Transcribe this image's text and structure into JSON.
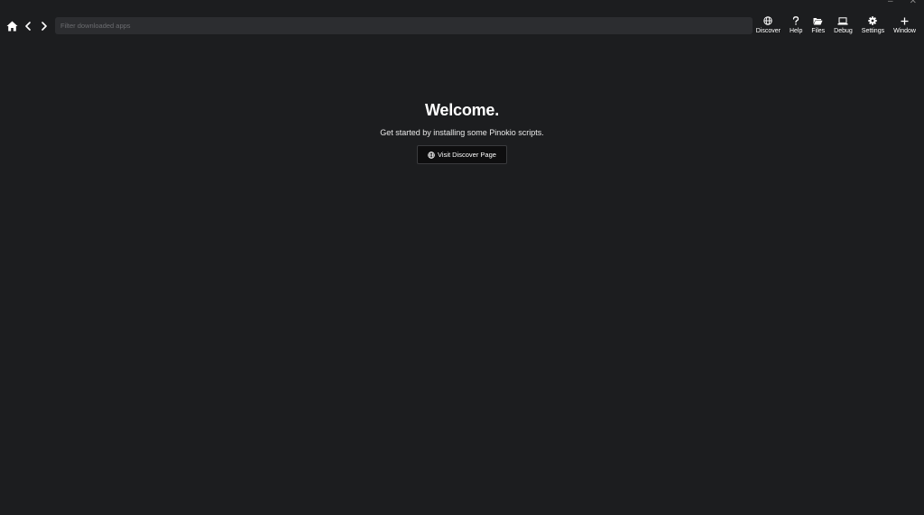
{
  "window": {
    "minimize_glyph": "–",
    "close_glyph": "✕"
  },
  "nav": {
    "home_icon": "home-icon",
    "back_icon": "chevron-left-icon",
    "forward_icon": "chevron-right-icon"
  },
  "search": {
    "placeholder": "Filter downloaded apps",
    "value": ""
  },
  "toolbar": {
    "items": [
      {
        "label": "Discover",
        "icon": "globe-icon"
      },
      {
        "label": "Help",
        "icon": "question-icon"
      },
      {
        "label": "Files",
        "icon": "folder-open-icon"
      },
      {
        "label": "Debug",
        "icon": "laptop-icon"
      },
      {
        "label": "Settings",
        "icon": "gear-icon"
      },
      {
        "label": "Window",
        "icon": "plus-icon"
      }
    ]
  },
  "main": {
    "title": "Welcome.",
    "subtitle": "Get started by installing some Pinokio scripts.",
    "discover_button_label": "Visit Discover Page",
    "discover_button_icon": "globe-icon"
  },
  "colors": {
    "background": "#1c1d1f",
    "search_bg": "#2c2d30",
    "button_bg": "#0e0e0f",
    "text": "#ffffff"
  }
}
